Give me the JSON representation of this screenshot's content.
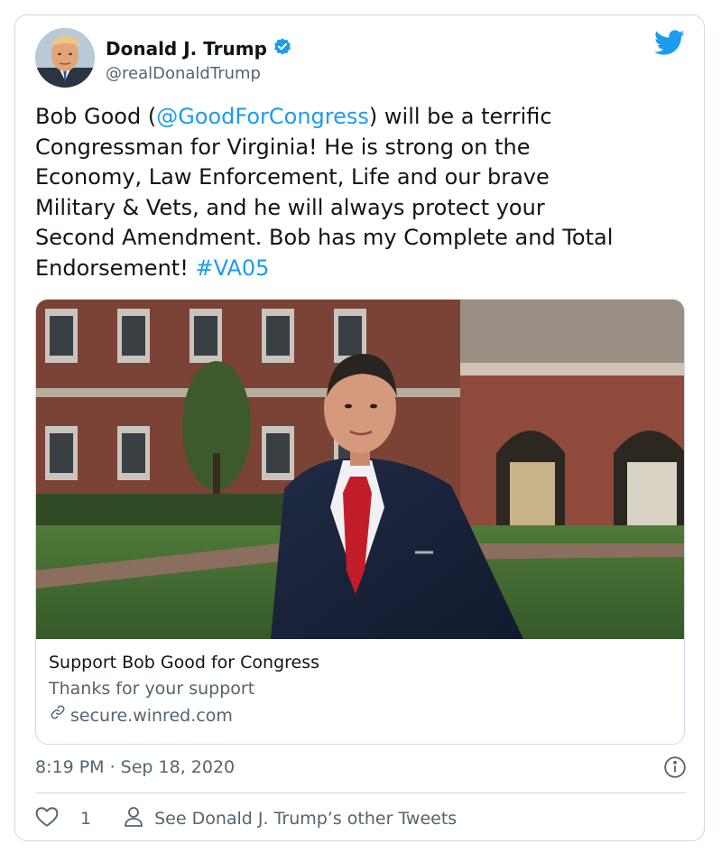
{
  "author": {
    "display_name": "Donald J. Trump",
    "handle": "@realDonaldTrump",
    "verified": true
  },
  "tweet": {
    "text_segments": [
      {
        "type": "text",
        "value": "Bob Good ("
      },
      {
        "type": "mention",
        "value": "@GoodForCongress"
      },
      {
        "type": "text",
        "value": ") will be a terrific\nCongressman for Virginia! He is strong on the\nEconomy, Law Enforcement, Life and our brave\nMilitary & Vets, and he will always protect your\nSecond Amendment. Bob has my Complete and Total\nEndorsement! "
      },
      {
        "type": "hashtag",
        "value": "#VA05"
      }
    ]
  },
  "link_card": {
    "title": "Support Bob Good for Congress",
    "description": "Thanks for your support",
    "domain": "secure.winred.com"
  },
  "timestamp": "8:19 PM · Sep 18, 2020",
  "actions": {
    "like_count": "1",
    "other_tweets_label": "See Donald J. Trump’s other Tweets"
  },
  "icons": {
    "brand": "twitter-bird-icon",
    "verified": "verified-badge-icon",
    "link": "link-icon",
    "info": "info-icon",
    "like": "heart-icon",
    "profile": "person-icon"
  },
  "colors": {
    "accent": "#1d9bf0",
    "text": "#0f1419",
    "secondary": "#536471",
    "border": "#cfd9de"
  }
}
